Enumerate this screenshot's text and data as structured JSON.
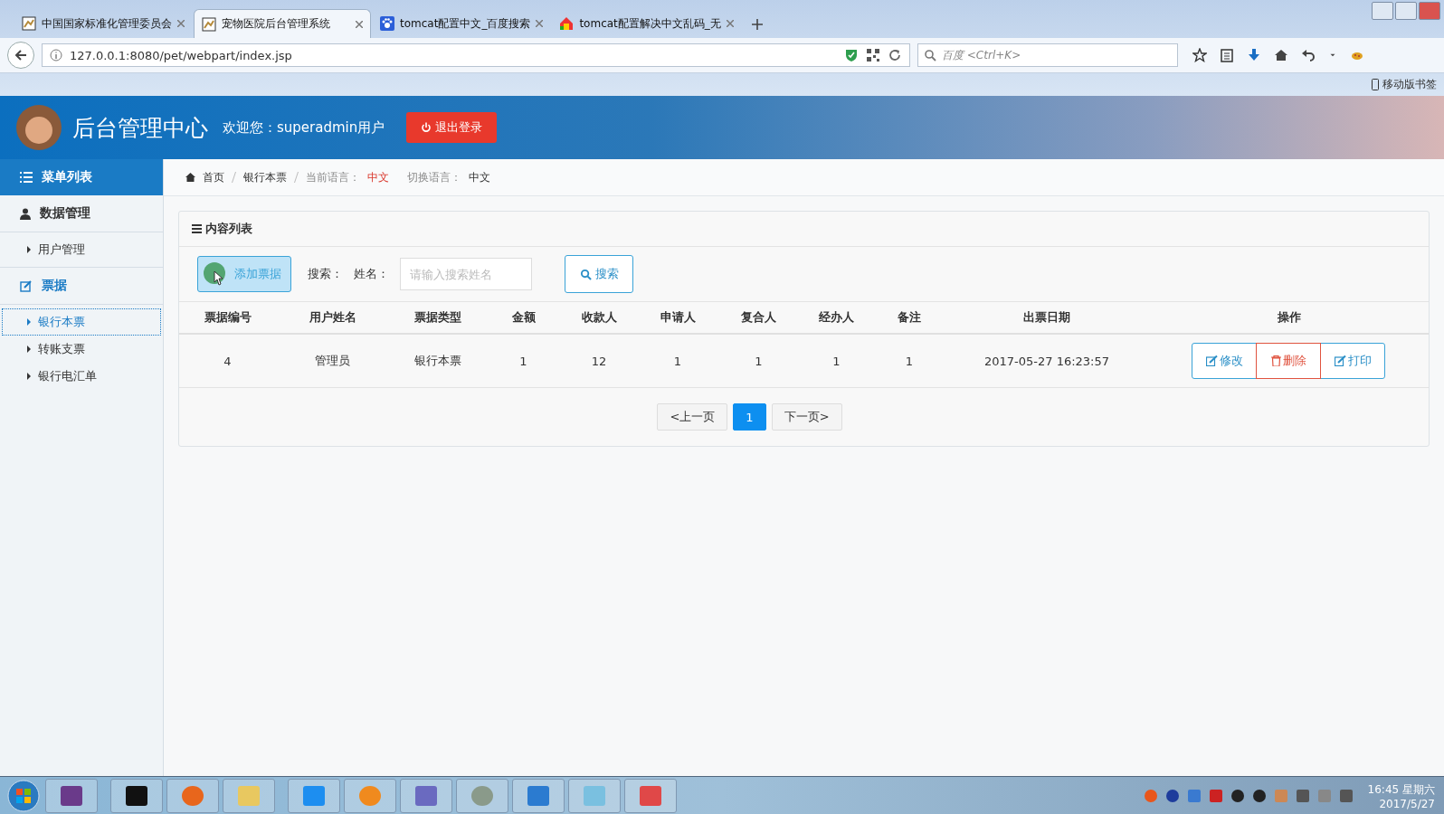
{
  "browser": {
    "tabs": [
      {
        "title": "中国国家标准化管理委员会",
        "selected": false
      },
      {
        "title": "宠物医院后台管理系统",
        "selected": true
      },
      {
        "title": "tomcat配置中文_百度搜索",
        "selected": false
      },
      {
        "title": "tomcat配置解决中文乱码_无",
        "selected": false
      }
    ],
    "url": "127.0.0.1:8080/pet/webpart/index.jsp",
    "search_placeholder": "百度 <Ctrl+K>",
    "bookmark_label": "移动版书签"
  },
  "header": {
    "title": "后台管理中心",
    "welcome": "欢迎您：superadmin用户",
    "logout": "退出登录"
  },
  "sidebar": {
    "heading": "菜单列表",
    "groups": [
      {
        "label": "数据管理",
        "selected": false,
        "children": [
          {
            "label": "用户管理",
            "selected": false
          }
        ]
      },
      {
        "label": "票据",
        "selected": true,
        "children": [
          {
            "label": "银行本票",
            "selected": true
          },
          {
            "label": "转账支票",
            "selected": false
          },
          {
            "label": "银行电汇单",
            "selected": false
          }
        ]
      }
    ]
  },
  "breadcrumb": {
    "items": [
      "首页",
      "银行本票"
    ],
    "lang_label": "当前语言：",
    "lang_value": "中文",
    "switch_label": "切换语言：",
    "switch_value": "中文"
  },
  "panel": {
    "title": "内容列表",
    "add_button": "添加票据",
    "search_label": "搜索：",
    "name_label": "姓名：",
    "placeholder": "请输入搜索姓名",
    "search_button": "搜索"
  },
  "table": {
    "columns": [
      "票据编号",
      "用户姓名",
      "票据类型",
      "金额",
      "收款人",
      "申请人",
      "复合人",
      "经办人",
      "备注",
      "出票日期",
      "操作"
    ],
    "rows": [
      {
        "cells": [
          "4",
          "管理员",
          "银行本票",
          "1",
          "12",
          "1",
          "1",
          "1",
          "1",
          "2017-05-27 16:23:57"
        ],
        "actions": [
          {
            "label": "修改",
            "kind": "edit"
          },
          {
            "label": "删除",
            "kind": "delete"
          },
          {
            "label": "打印",
            "kind": "print"
          }
        ]
      }
    ]
  },
  "pagination": {
    "prev": "<上一页",
    "pages": [
      {
        "label": "1",
        "selected": true
      }
    ],
    "next": "下一页>"
  },
  "taskbar": {
    "time": "16:45 星期六",
    "date": "2017/5/27"
  }
}
